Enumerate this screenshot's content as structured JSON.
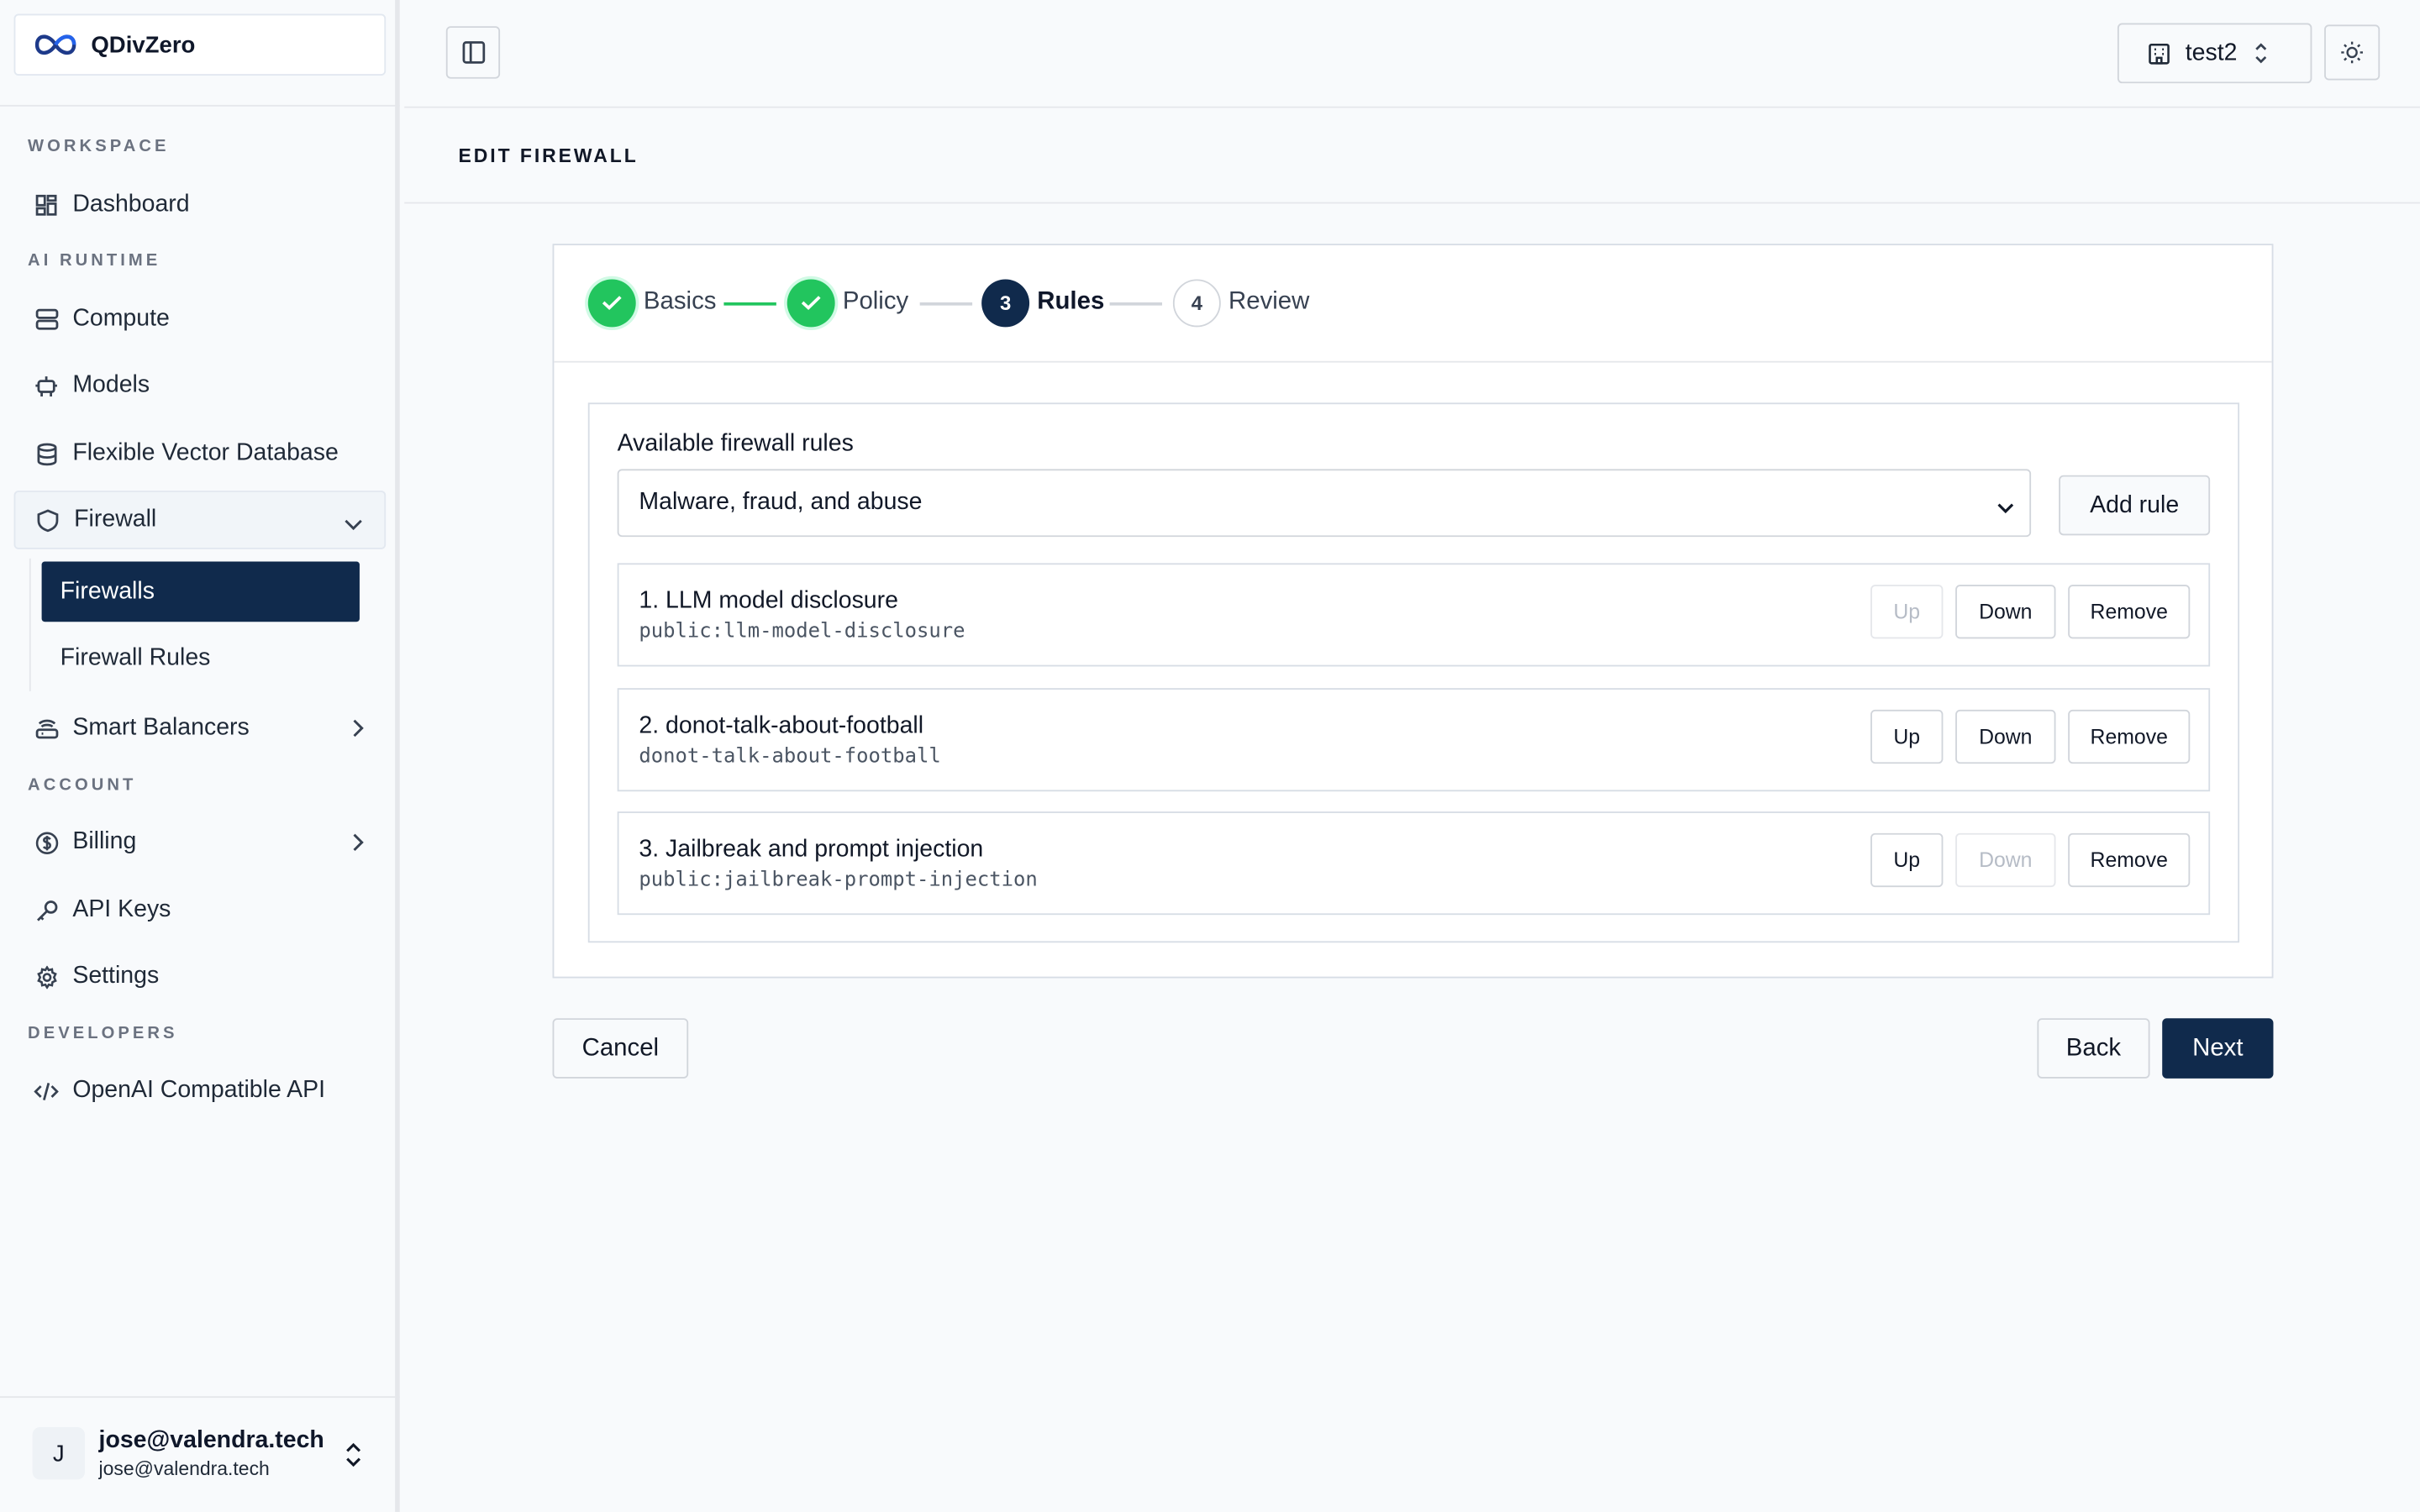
{
  "brand": {
    "name": "QDivZero"
  },
  "sidebar": {
    "sections": {
      "workspace": "WORKSPACE",
      "ai_runtime": "AI RUNTIME",
      "account": "ACCOUNT",
      "developers": "DEVELOPERS"
    },
    "items": {
      "dashboard": "Dashboard",
      "compute": "Compute",
      "models": "Models",
      "vector_db": "Flexible Vector Database",
      "firewall": "Firewall",
      "firewalls": "Firewalls",
      "firewall_rules": "Firewall Rules",
      "smart_balancers": "Smart Balancers",
      "billing": "Billing",
      "api_keys": "API Keys",
      "settings": "Settings",
      "openai_api": "OpenAI Compatible API"
    },
    "active_item": "Firewalls"
  },
  "user": {
    "initial": "J",
    "name": "jose@valendra.tech",
    "email": "jose@valendra.tech"
  },
  "header": {
    "org": "test2"
  },
  "page": {
    "title": "EDIT FIREWALL"
  },
  "stepper": {
    "steps": [
      {
        "number": "1",
        "label": "Basics",
        "state": "done"
      },
      {
        "number": "2",
        "label": "Policy",
        "state": "done"
      },
      {
        "number": "3",
        "label": "Rules",
        "state": "current"
      },
      {
        "number": "4",
        "label": "Review",
        "state": "todo"
      }
    ]
  },
  "rules_panel": {
    "label": "Available firewall rules",
    "selected": "Malware, fraud, and abuse",
    "add_label": "Add rule",
    "rules": [
      {
        "name": "1. LLM model disclosure",
        "id": "public:llm-model-disclosure",
        "up_enabled": false,
        "down_enabled": true
      },
      {
        "name": "2. donot-talk-about-football",
        "id": "donot-talk-about-football",
        "up_enabled": true,
        "down_enabled": true
      },
      {
        "name": "3. Jailbreak and prompt injection",
        "id": "public:jailbreak-prompt-injection",
        "up_enabled": true,
        "down_enabled": false
      }
    ],
    "up_label": "Up",
    "down_label": "Down",
    "remove_label": "Remove"
  },
  "footer": {
    "cancel": "Cancel",
    "back": "Back",
    "next": "Next"
  },
  "colors": {
    "primary": "#102a4c",
    "success": "#22c55e",
    "border": "#d1d5db"
  }
}
